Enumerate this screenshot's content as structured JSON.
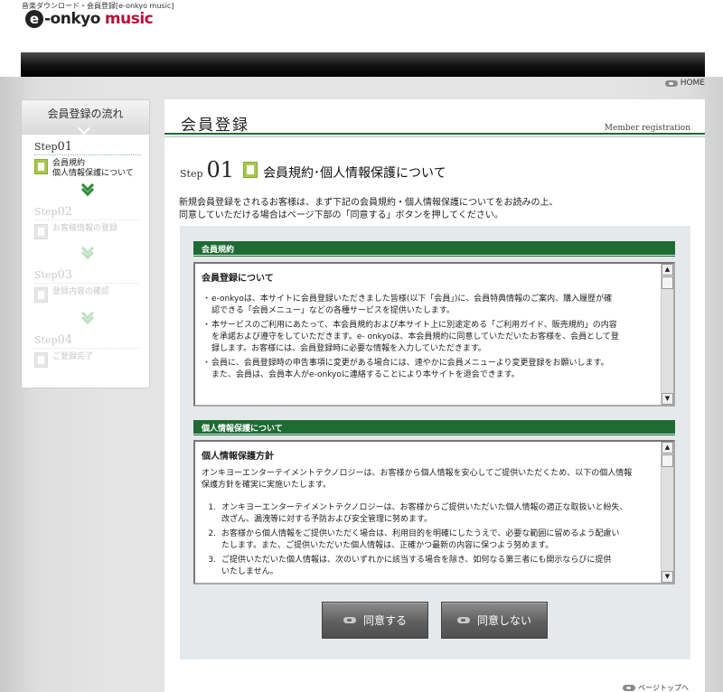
{
  "header": {
    "caption": "音楽ダウンロード・会員登録[e-onkyo music]",
    "logo_e": "e",
    "logo_main": "-onkyo",
    "logo_accent": "music",
    "home_label": "HOME"
  },
  "sidebar": {
    "title": "会員登録の流れ",
    "steps": [
      {
        "label": "Step",
        "num": "01",
        "text_line1": "会員規約",
        "text_line2": "個人情報保護について"
      },
      {
        "label": "Step",
        "num": "02",
        "text_line1": "お客様情報の登録"
      },
      {
        "label": "Step",
        "num": "03",
        "text_line1": "登録内容の確認"
      },
      {
        "label": "Step",
        "num": "04",
        "text_line1": "ご登録完了"
      }
    ]
  },
  "main": {
    "title": "会員登録",
    "subtitle": "Member registration",
    "step_word": "Step",
    "step_num": "01",
    "step_title": "会員規約･個人情報保護について",
    "intro_line1": "新規会員登録をされるお客様は、まず下記の会員規約・個人情報保護についてをお読みの上、",
    "intro_line2": "同意していただける場合はページ下部の「同意する」ボタンを押してください。",
    "terms": {
      "section_title": "会員規約",
      "heading": "会員登録について",
      "paragraphs": [
        {
          "line1": "e-onkyoは、本サイトに会員登録いただきました皆様(以下「会員」)に、会員特典情報のご案内、購入履歴が確",
          "line2": "認できる「会員メニュー」などの各種サービスを提供いたします。"
        },
        {
          "line1": "本サービスのご利用にあたって、本会員規約および本サイト上に別途定める「ご利用ガイド、販売規約」の内容",
          "line2": "を承諾および遵守をしていただきます。e- onkyoは、本会員規約に同意していただいたお客様を、会員として登",
          "line3": "録します。お客様には、会員登録時に必要な情報を入力していただきます。"
        },
        {
          "line1": "会員に、会員登録時の申告事項に変更がある場合には、速やかに会員メニューより変更登録をお願いします。",
          "line2": "また、会員は、会員本人がe-onkyoに連絡することにより本サイトを退会できます。"
        }
      ]
    },
    "privacy": {
      "section_title": "個人情報保護について",
      "heading": "個人情報保護方針",
      "lead_line1": "オンキヨーエンターテイメントテクノロジーは、お客様から個人情報を安心してご提供いただくため、以下の個人情報",
      "lead_line2": "保護方針を確実に実施いたします。",
      "items": [
        {
          "num": "1.",
          "line1": "オンキヨーエンターテイメントテクノロジーは、お客様からご提供いただいた個人情報の適正な取扱いと紛失、",
          "line2": "改ざん、漏洩等に対する予防および安全管理に努めます。"
        },
        {
          "num": "2.",
          "line1": "お客様から個人情報をご提供いただく場合は、利用目的を明確にしたうえで、必要な範囲に留めるよう配慮い",
          "line2": "たします。また、ご提供いただいた個人情報は、正確かつ最新の内容に保つよう努めます。"
        },
        {
          "num": "3.",
          "line1": "ご提供いただいた個人情報は、次のいずれかに該当する場合を除き、如何なる第三者にも開示ならびに提供",
          "line2": "いたしません。"
        }
      ]
    },
    "agree_label": "同意する",
    "disagree_label": "同意しない"
  },
  "footer": {
    "pagetop_label": "ページトップへ"
  }
}
